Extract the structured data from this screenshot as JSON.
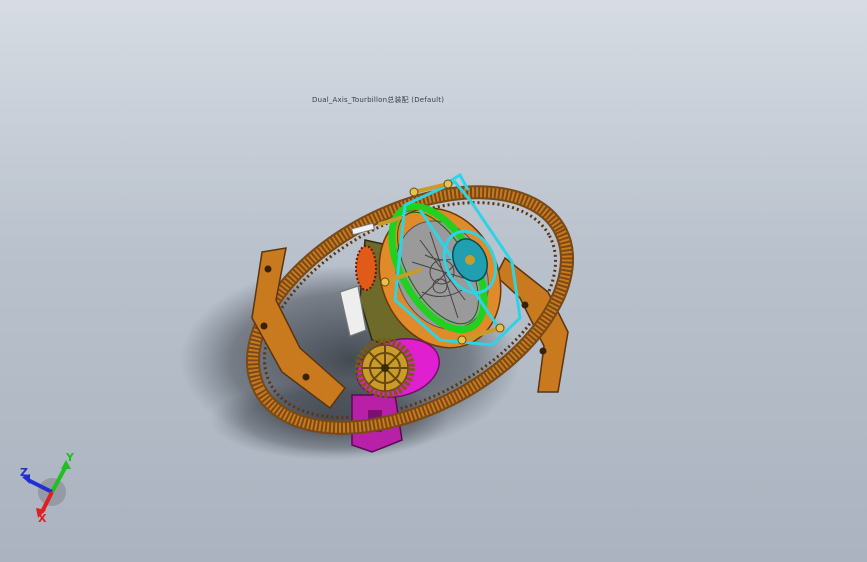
{
  "viewport": {
    "model_title": "Dual_Axis_Tourbillon总装配 (Default)",
    "colors": {
      "background_top": "#d7dce3",
      "background_bottom": "#aab3bf",
      "ring": "#c97a1f",
      "ring_teeth": "#7a4a16",
      "cage_green": "#22d020",
      "cage_cyan": "#2fd3e6",
      "wheel_gold": "#c89b2a",
      "magenta_part": "#e020d0",
      "dark_olive": "#6d6a2a"
    }
  },
  "triad": {
    "x_label": "X",
    "y_label": "Y",
    "z_label": "Z",
    "colors": {
      "x": "#e02020",
      "y": "#20c020",
      "z": "#2030d0"
    }
  }
}
